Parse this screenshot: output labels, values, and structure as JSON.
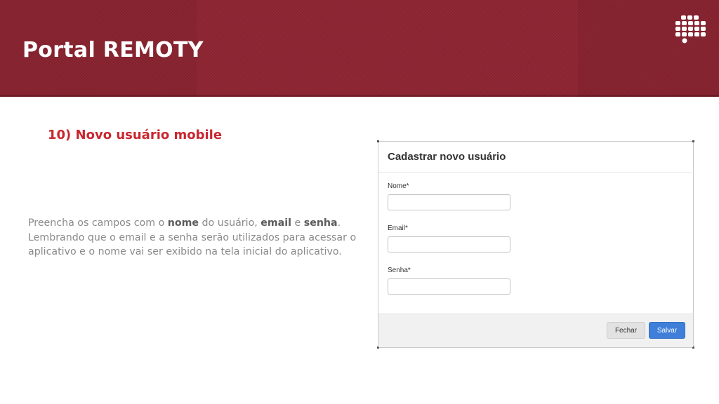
{
  "header": {
    "title": "Portal REMOTY",
    "brand_logo_icon": "grid-dots-logo-icon",
    "background_color": "#8d2431"
  },
  "section": {
    "heading": "10) Novo usuário mobile",
    "heading_color": "#c9262f"
  },
  "instructions": {
    "p1": "Preencha os campos com o ",
    "nome": "nome",
    "p2": " do usuário, ",
    "email": "email",
    "p3": " e  ",
    "senha": "senha",
    "p4": ". Lembrando que o email e a senha serão utilizados para acessar o aplicativo e o nome vai ser exibido na tela inicial do aplicativo."
  },
  "modal": {
    "title": "Cadastrar novo usuário",
    "fields": [
      {
        "label": "Nome*",
        "value": "",
        "placeholder": ""
      },
      {
        "label": "Email*",
        "value": "",
        "placeholder": ""
      },
      {
        "label": "Senha*",
        "value": "",
        "placeholder": ""
      }
    ],
    "buttons": {
      "close": "Fechar",
      "save": "Salvar"
    },
    "save_color": "#3f7fd9"
  }
}
